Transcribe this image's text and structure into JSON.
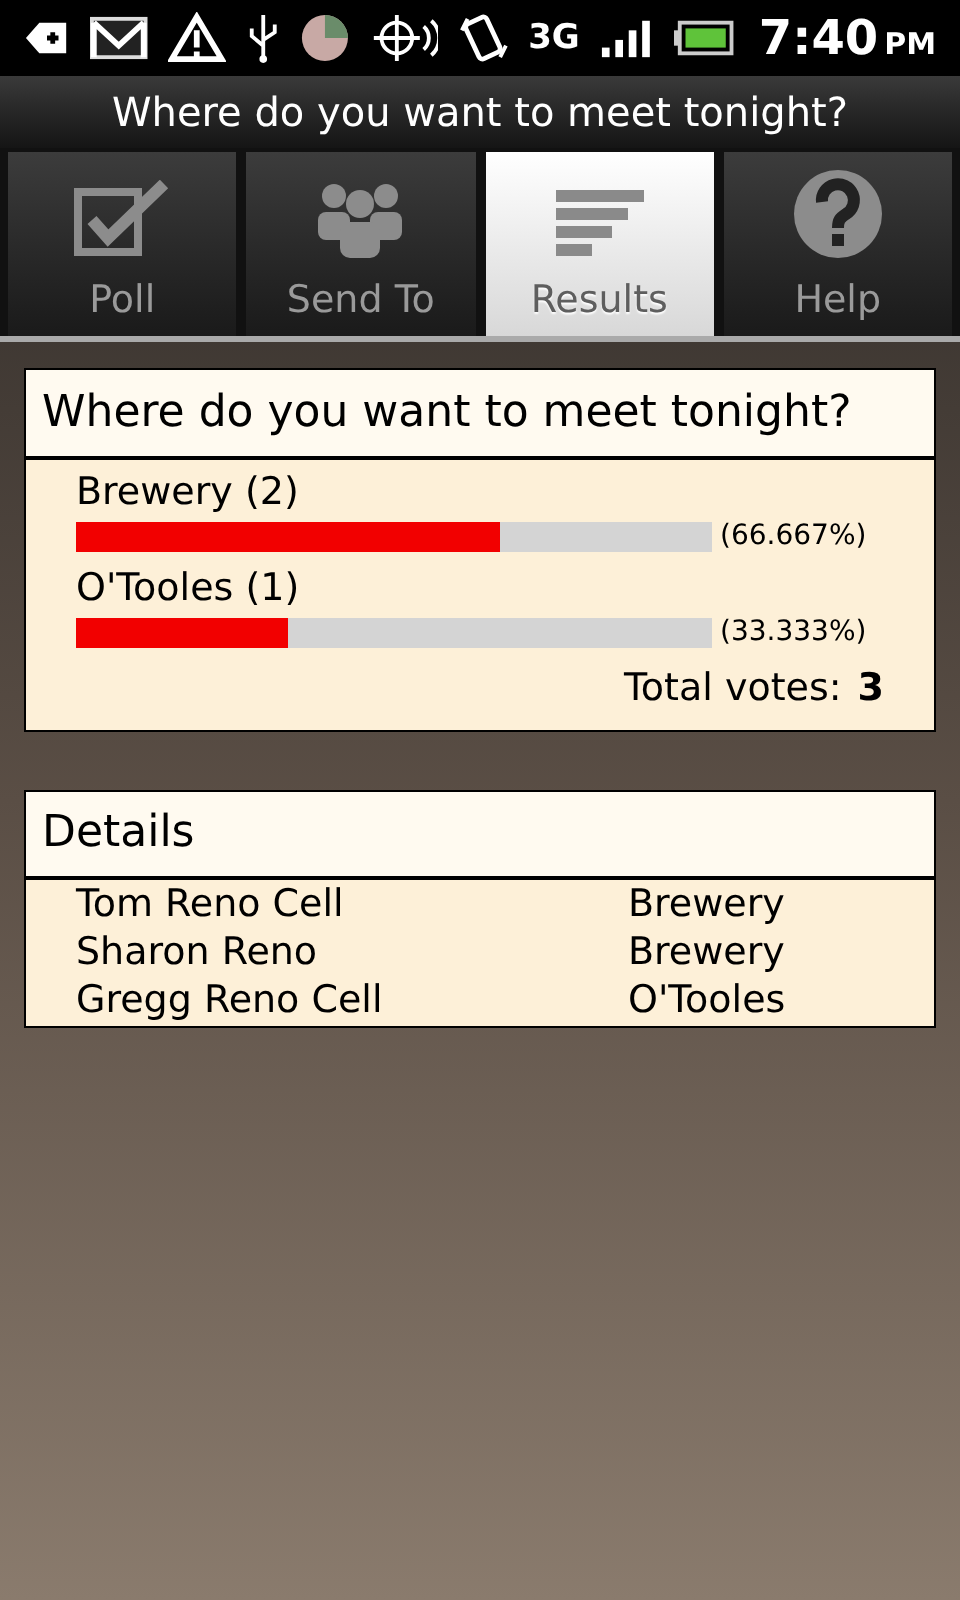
{
  "status_bar": {
    "network": "3G",
    "time": "7:40",
    "ampm": "PM"
  },
  "title": "Where do you want to meet tonight?",
  "tabs": [
    {
      "label": "Poll",
      "kind": "poll",
      "selected": false
    },
    {
      "label": "Send To",
      "kind": "contacts",
      "selected": false
    },
    {
      "label": "Results",
      "kind": "results",
      "selected": true
    },
    {
      "label": "Help",
      "kind": "help",
      "selected": false
    }
  ],
  "results": {
    "question": "Where do you want to meet tonight?",
    "options": [
      {
        "label": "Brewery (2)",
        "level": 0.66667,
        "percent": "(66.667%)"
      },
      {
        "label": "O'Tooles (1)",
        "level": 0.33333,
        "percent": "(33.333%)"
      }
    ],
    "total_label": "Total votes:",
    "total": "3"
  },
  "details": {
    "title": "Details",
    "rows": [
      {
        "name": "Tom Reno Cell",
        "choice": "Brewery"
      },
      {
        "name": "Sharon Reno",
        "choice": "Brewery"
      },
      {
        "name": "Gregg Reno Cell",
        "choice": "O'Tooles"
      }
    ]
  }
}
